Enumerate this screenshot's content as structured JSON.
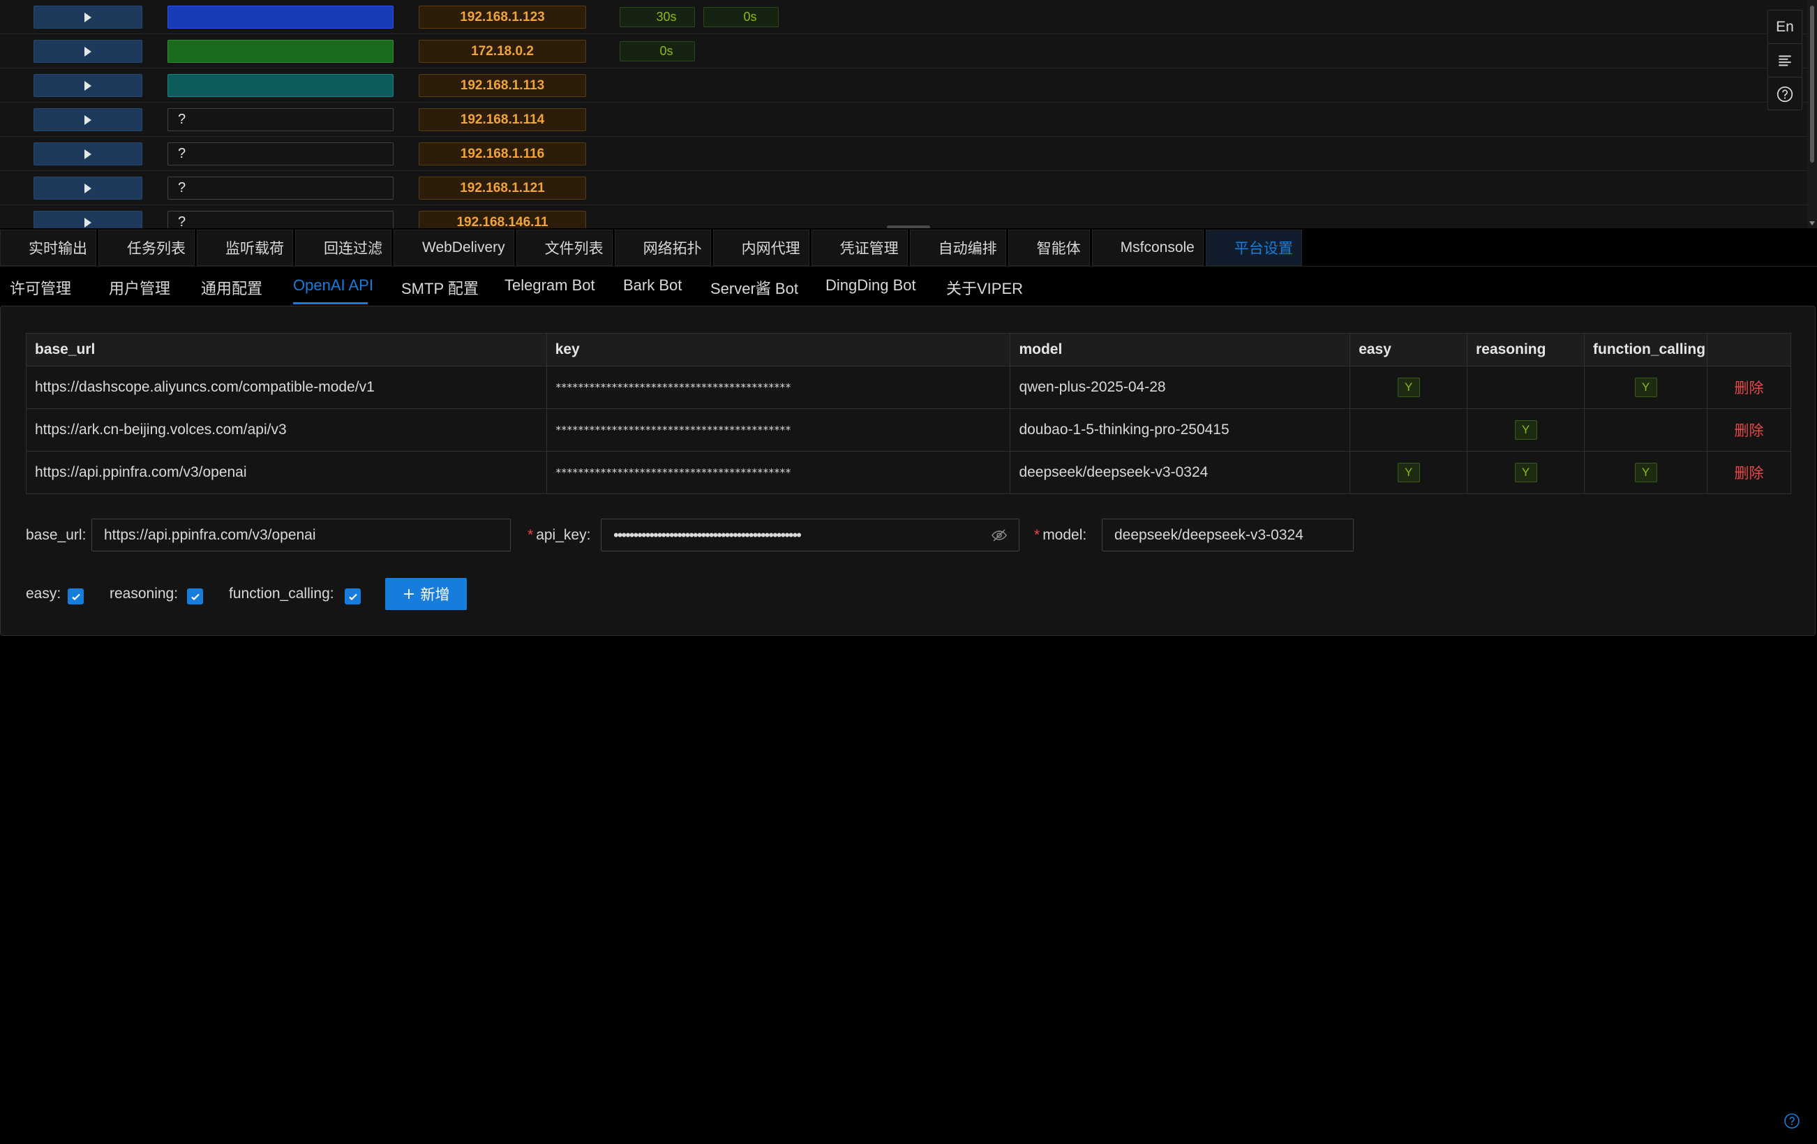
{
  "hosts": [
    {
      "os": "windows",
      "ip": "192.168.1.123",
      "heartbeats": [
        "30s",
        "0s"
      ]
    },
    {
      "os": "linux",
      "ip": "172.18.0.2",
      "heartbeats": [
        "0s"
      ]
    },
    {
      "os": "cloud",
      "ip": "192.168.1.113",
      "heartbeats": []
    },
    {
      "os": "unknown",
      "os_label": "?",
      "ip": "192.168.1.114",
      "heartbeats": []
    },
    {
      "os": "unknown",
      "os_label": "?",
      "ip": "192.168.1.116",
      "heartbeats": []
    },
    {
      "os": "unknown",
      "os_label": "?",
      "ip": "192.168.1.121",
      "heartbeats": []
    },
    {
      "os": "unknown",
      "os_label": "?",
      "ip": "192.168.146.11",
      "heartbeats": []
    }
  ],
  "float_buttons": {
    "lang": "En",
    "menu_icon": "menu-icon",
    "help_icon": "help-icon"
  },
  "main_tabs": [
    {
      "label": "实时输出",
      "icon": "console-icon"
    },
    {
      "label": "任务列表",
      "icon": "history-icon"
    },
    {
      "label": "监听载荷",
      "icon": "headset-icon"
    },
    {
      "label": "回连过滤",
      "icon": "filter-icon"
    },
    {
      "label": "WebDelivery",
      "icon": "cloud-upload-icon"
    },
    {
      "label": "文件列表",
      "icon": "folder-icon"
    },
    {
      "label": "网络拓扑",
      "icon": "topology-icon"
    },
    {
      "label": "内网代理",
      "icon": "proxy-icon"
    },
    {
      "label": "凭证管理",
      "icon": "key-search-icon"
    },
    {
      "label": "自动编排",
      "icon": "document-icon"
    },
    {
      "label": "智能体",
      "icon": "agent-icon"
    },
    {
      "label": "Msfconsole",
      "icon": "terminal-icon"
    },
    {
      "label": "平台设置",
      "icon": "gear-icon",
      "active": true
    }
  ],
  "sub_tabs": [
    {
      "label": "许可管理"
    },
    {
      "label": "用户管理"
    },
    {
      "label": "通用配置"
    },
    {
      "label": "OpenAI API",
      "active": true
    },
    {
      "label": "SMTP 配置"
    },
    {
      "label": "Telegram Bot"
    },
    {
      "label": "Bark Bot"
    },
    {
      "label": "Server酱 Bot"
    },
    {
      "label": "DingDing Bot"
    },
    {
      "label": "关于VIPER"
    }
  ],
  "api_table": {
    "columns": [
      "base_url",
      "key",
      "model",
      "easy",
      "reasoning",
      "function_calling",
      ""
    ],
    "rows": [
      {
        "base_url": "https://dashscope.aliyuncs.com/compatible-mode/v1",
        "key": "******************************************",
        "model": "qwen-plus-2025-04-28",
        "easy": "Y",
        "reasoning": "",
        "function_calling": "Y",
        "action": "删除"
      },
      {
        "base_url": "https://ark.cn-beijing.volces.com/api/v3",
        "key": "******************************************",
        "model": "doubao-1-5-thinking-pro-250415",
        "easy": "",
        "reasoning": "Y",
        "function_calling": "",
        "action": "删除"
      },
      {
        "base_url": "https://api.ppinfra.com/v3/openai",
        "key": "******************************************",
        "model": "deepseek/deepseek-v3-0324",
        "easy": "Y",
        "reasoning": "Y",
        "function_calling": "Y",
        "action": "删除"
      }
    ]
  },
  "form": {
    "base_url_label": "base_url",
    "base_url_value": "https://api.ppinfra.com/v3/openai",
    "api_key_label": "api_key",
    "api_key_value": "•••••••••••••••••••••••••••••••••••••••••••••••",
    "model_label": "model",
    "model_value": "deepseek/deepseek-v3-0324",
    "easy_label": "easy",
    "reasoning_label": "reasoning",
    "function_calling_label": "function_calling",
    "easy_checked": true,
    "reasoning_checked": true,
    "function_calling_checked": true,
    "add_button": "新增"
  },
  "colors": {
    "accent": "#177ddc",
    "danger": "#e84749",
    "ip_text": "#f0a43a",
    "heartbeat": "#8bbb11"
  }
}
